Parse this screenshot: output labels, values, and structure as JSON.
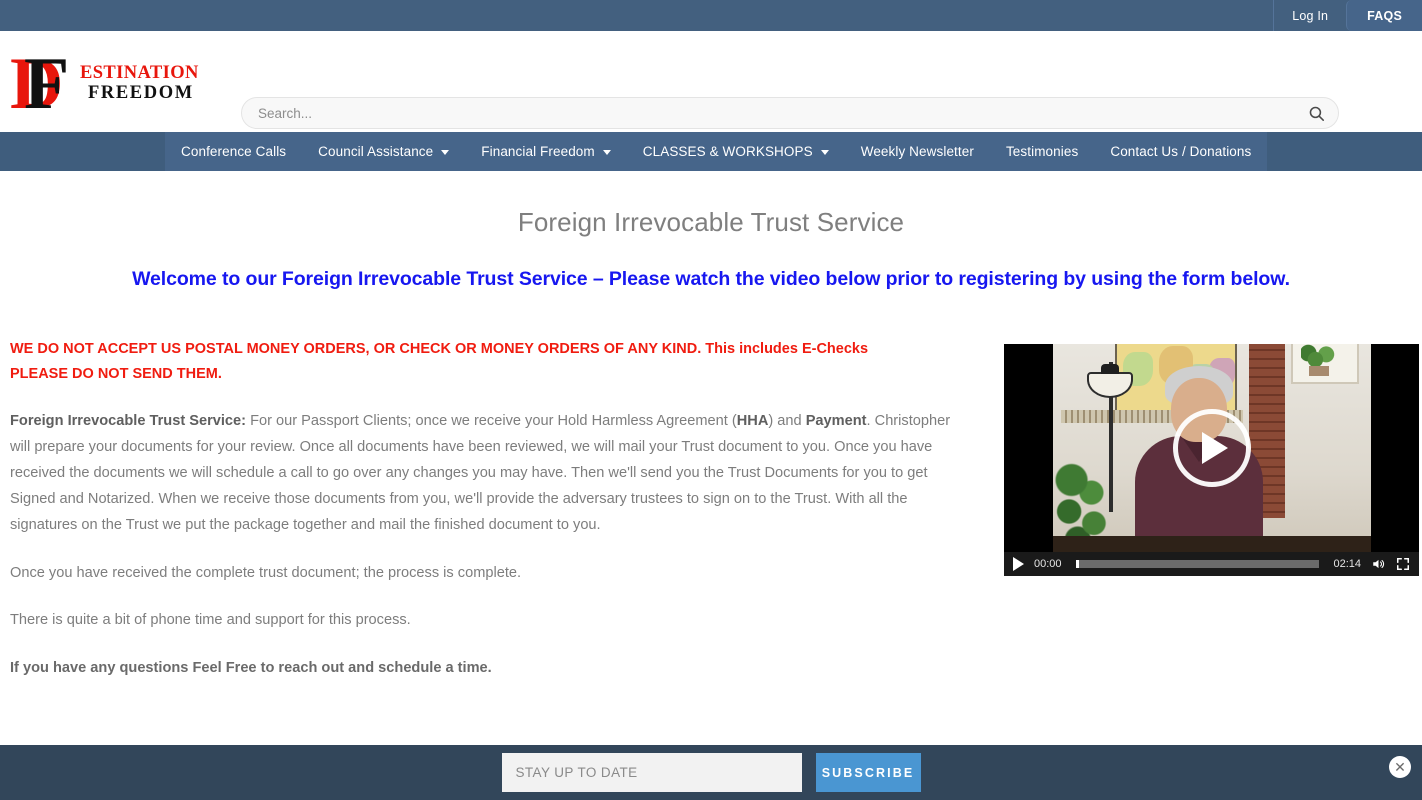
{
  "topbar": {
    "login_label": "Log In",
    "faqs_label": "FAQS"
  },
  "header": {
    "logo": {
      "letter_d": "D",
      "letter_f": "F",
      "word_top": "ESTINATION",
      "word_bottom": "FREEDOM"
    },
    "search": {
      "placeholder": "Search...",
      "value": "",
      "icon": "search-icon"
    }
  },
  "nav": {
    "items": [
      {
        "label": "Conference Calls",
        "has_dropdown": false
      },
      {
        "label": "Council Assistance",
        "has_dropdown": true
      },
      {
        "label": "Financial Freedom",
        "has_dropdown": true
      },
      {
        "label": "CLASSES & WORKSHOPS",
        "has_dropdown": true
      },
      {
        "label": "Weekly Newsletter",
        "has_dropdown": false
      },
      {
        "label": "Testimonies",
        "has_dropdown": false
      },
      {
        "label": "Contact Us / Donations",
        "has_dropdown": false
      }
    ]
  },
  "page": {
    "title": "Foreign Irrevocable Trust Service",
    "welcome": "Welcome to our Foreign Irrevocable Trust Service – Please watch the video below prior to registering by using the form below.",
    "warning_line1": "WE DO NOT ACCEPT US POSTAL MONEY ORDERS, OR CHECK OR MONEY ORDERS OF ANY KIND. This includes E-Checks",
    "warning_line2": "PLEASE DO NOT SEND THEM.",
    "para1_lead": "Foreign Irrevocable Trust Service:",
    "para1_part1": " For our Passport Clients; once we receive your Hold Harmless Agreement (",
    "para1_hha": "HHA",
    "para1_part2": ") and ",
    "para1_payment": "Payment",
    "para1_part3": ". Christopher will prepare your documents for your review. Once all documents have been reviewed, we will mail your Trust document to you. Once you have received the documents we will schedule a call to go over any changes you may have. Then we'll send you the Trust Documents for you to get Signed and Notarized. When we receive those documents from you, we'll provide the adversary trustees to sign on to the Trust. With all the signatures on the Trust we put the package together and mail the finished document to you.",
    "para2": "Once you have received the complete trust document; the process is complete.",
    "para3": "There is quite a bit of phone time and support for this process.",
    "para4": "If you have any questions Feel Free to reach out and schedule a time."
  },
  "video": {
    "current_time": "00:00",
    "duration": "02:14",
    "progress_percent": 0,
    "play_icon": "play-icon",
    "mute_icon": "volume-icon",
    "fullscreen_icon": "fullscreen-icon"
  },
  "subscribe_bar": {
    "input_placeholder": "STAY UP TO DATE",
    "input_value": "",
    "button_label": "SUBSCRIBE",
    "close_icon": "close-icon",
    "accent_color": "#4a96d2",
    "background_color": "#32465a"
  },
  "colors": {
    "topbar": "#43607f",
    "navbar": "#3f5d7d",
    "nav_center": "#46658a",
    "heading_grey": "#7f7f7f",
    "welcome_blue": "#1717f0",
    "warning_red": "#f01c10"
  }
}
